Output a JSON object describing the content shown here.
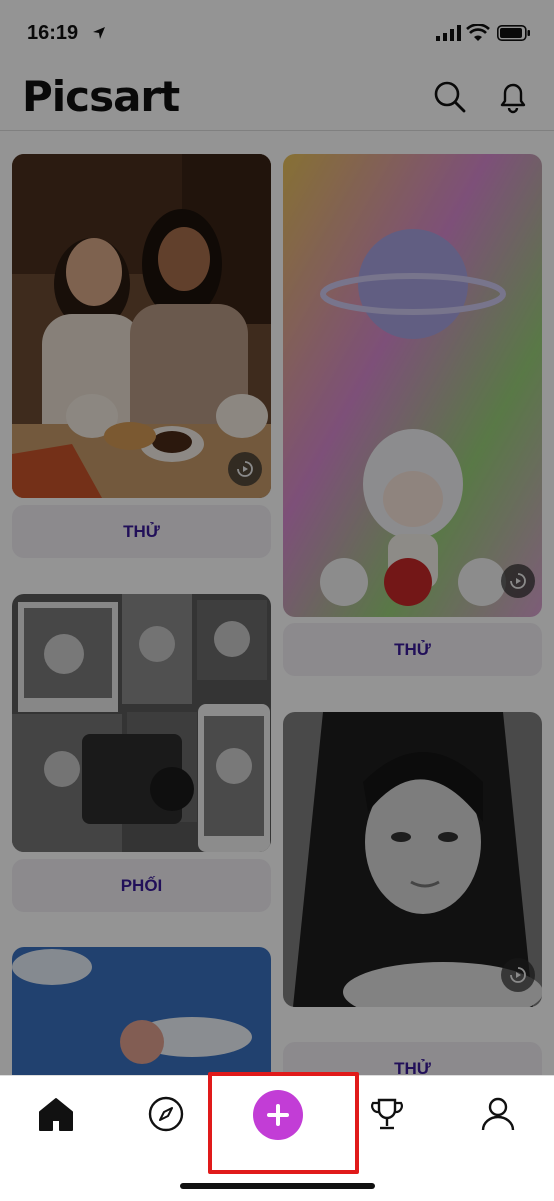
{
  "status_bar": {
    "time": "16:19"
  },
  "header": {
    "logo": "Picsart"
  },
  "feed": {
    "buttons": [
      "THỬ",
      "PHỐI",
      "THỬ",
      "THỬ"
    ]
  },
  "colors": {
    "accent": "#c23dd6",
    "button_text": "#3a1a9a",
    "highlight": "#e01a1a"
  },
  "tabbar": {
    "icons": [
      "home-icon",
      "compass-icon",
      "plus-icon",
      "trophy-icon",
      "profile-icon"
    ]
  }
}
